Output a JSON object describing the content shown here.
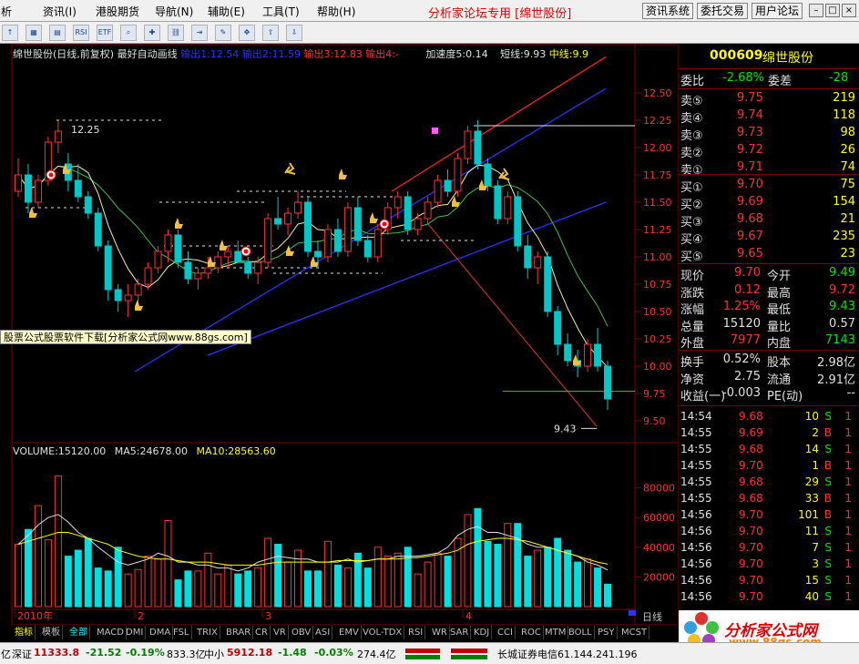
{
  "menu": {
    "items": [
      "析",
      "资讯(I)",
      "港股期货",
      "导航(N)",
      "辅助(E)",
      "工具(T)",
      "帮助(H)"
    ],
    "title": "分析家论坛专用 [绵世股份]",
    "system_buttons": [
      "资讯系统",
      "委托交易",
      "用户论坛"
    ],
    "window_buttons": [
      "–",
      "□",
      "×"
    ]
  },
  "toolbar": {
    "icons": [
      "arrow-up-icon",
      "chart-icon",
      "bar-chart-icon",
      "rsi-icon",
      "etf-icon",
      "zoom-icon",
      "tool-icon",
      "link-icon",
      "import-icon",
      "pen-icon",
      "move-icon",
      "up-arrow-icon",
      "down-arrow-icon"
    ],
    "labels": [
      "↑",
      "▦",
      "▤",
      "RSI",
      "ETF",
      "⌕",
      "✚",
      "⛓",
      "⇥",
      "✎",
      "✥",
      "⇧",
      "⇩"
    ]
  },
  "chart_header": {
    "name": "绵世股份(日线,前复权)",
    "mode": "最好自动画线",
    "out1": "输出1:12.54",
    "out2": "输出2:11.59",
    "out3": "输出3:12.83",
    "out4": "输出4:-",
    "accel": "加速度5:0.14",
    "short": "短线:9.93",
    "mid": "中线:9.9"
  },
  "annotations": {
    "high": "12.25",
    "low": "9.43"
  },
  "ad_banner": "股票公式股票软件下载[分析家公式网www.88gs.com]",
  "volume_header": {
    "volume": "VOLUME:15120.00",
    "ma5": "MA5:24678.00",
    "ma10": "MA10:28563.60"
  },
  "x_axis": {
    "labels": [
      "2010年",
      "2",
      "3",
      "4"
    ]
  },
  "day_tag": "日线",
  "chart_data": [
    {
      "type": "candlestick",
      "title": "绵世股份(日线,前复权)",
      "y_ticks": [
        "12.50",
        "12.25",
        "12.00",
        "11.75",
        "11.50",
        "11.25",
        "11.00",
        "10.75",
        "10.50",
        "10.25",
        "10.00",
        "9.75",
        "9.50"
      ],
      "ylim": [
        9.35,
        12.75
      ],
      "candles": [
        [
          11.6,
          11.9,
          11.55,
          11.75
        ],
        [
          11.75,
          11.85,
          11.4,
          11.5
        ],
        [
          11.5,
          11.75,
          11.45,
          11.7
        ],
        [
          11.7,
          12.1,
          11.65,
          12.05
        ],
        [
          12.05,
          12.25,
          11.95,
          12.15
        ],
        [
          11.85,
          11.95,
          11.6,
          11.7
        ],
        [
          11.7,
          11.85,
          11.5,
          11.55
        ],
        [
          11.55,
          11.6,
          11.35,
          11.4
        ],
        [
          11.4,
          11.45,
          11.05,
          11.1
        ],
        [
          11.1,
          11.15,
          10.6,
          10.7
        ],
        [
          10.7,
          10.75,
          10.5,
          10.6
        ],
        [
          10.6,
          10.75,
          10.45,
          10.65
        ],
        [
          10.65,
          10.8,
          10.55,
          10.75
        ],
        [
          10.75,
          10.95,
          10.7,
          10.9
        ],
        [
          10.9,
          11.1,
          10.85,
          11.05
        ],
        [
          11.05,
          11.25,
          10.95,
          11.2
        ],
        [
          11.2,
          11.25,
          10.9,
          10.95
        ],
        [
          10.95,
          11.05,
          10.75,
          10.8
        ],
        [
          10.8,
          10.9,
          10.7,
          10.85
        ],
        [
          10.85,
          11.0,
          10.8,
          10.9
        ],
        [
          10.9,
          11.05,
          10.85,
          11.0
        ],
        [
          11.0,
          11.1,
          10.9,
          11.05
        ],
        [
          11.05,
          11.15,
          10.95,
          10.95
        ],
        [
          10.95,
          11.0,
          10.8,
          10.85
        ],
        [
          10.85,
          11.0,
          10.75,
          10.95
        ],
        [
          10.95,
          11.4,
          10.9,
          11.35
        ],
        [
          11.35,
          11.55,
          11.25,
          11.3
        ],
        [
          11.3,
          11.45,
          11.2,
          11.4
        ],
        [
          11.4,
          11.6,
          11.35,
          11.5
        ],
        [
          11.5,
          11.55,
          11.0,
          11.05
        ],
        [
          11.05,
          11.15,
          10.9,
          11.0
        ],
        [
          11.0,
          11.3,
          10.95,
          11.25
        ],
        [
          11.25,
          11.35,
          11.0,
          11.05
        ],
        [
          11.05,
          11.5,
          11.0,
          11.45
        ],
        [
          11.45,
          11.55,
          11.1,
          11.15
        ],
        [
          11.15,
          11.2,
          10.95,
          11.0
        ],
        [
          11.0,
          11.3,
          10.95,
          11.25
        ],
        [
          11.25,
          11.5,
          11.2,
          11.45
        ],
        [
          11.45,
          11.6,
          11.35,
          11.55
        ],
        [
          11.55,
          11.6,
          11.2,
          11.25
        ],
        [
          11.25,
          11.4,
          11.2,
          11.35
        ],
        [
          11.35,
          11.55,
          11.3,
          11.5
        ],
        [
          11.5,
          11.75,
          11.45,
          11.7
        ],
        [
          11.7,
          11.8,
          11.55,
          11.6
        ],
        [
          11.6,
          11.95,
          11.55,
          11.9
        ],
        [
          11.9,
          12.2,
          11.85,
          12.15
        ],
        [
          12.15,
          12.25,
          11.8,
          11.85
        ],
        [
          11.85,
          11.9,
          11.6,
          11.65
        ],
        [
          11.65,
          11.7,
          11.3,
          11.35
        ],
        [
          11.35,
          11.6,
          11.3,
          11.55
        ],
        [
          11.55,
          11.6,
          11.05,
          11.1
        ],
        [
          11.1,
          11.2,
          10.8,
          10.9
        ],
        [
          10.9,
          11.05,
          10.75,
          11.0
        ],
        [
          11.0,
          11.05,
          10.45,
          10.5
        ],
        [
          10.5,
          10.55,
          10.1,
          10.2
        ],
        [
          10.2,
          10.3,
          10.0,
          10.05
        ],
        [
          10.05,
          10.15,
          9.9,
          10.0
        ],
        [
          10.0,
          10.25,
          9.95,
          10.2
        ],
        [
          10.2,
          10.35,
          9.95,
          10.0
        ],
        [
          10.0,
          10.05,
          9.6,
          9.7
        ]
      ],
      "lines": [
        {
          "name": "输出1",
          "color": "#3030ff",
          "from": [
            9.95
          ],
          "to": [
            12.54
          ]
        },
        {
          "name": "输出3",
          "color": "#ff2020",
          "from": [
            11.6
          ],
          "to": [
            12.83
          ]
        }
      ]
    },
    {
      "type": "bar",
      "title": "VOLUME",
      "y_ticks": [
        "80000",
        "60000",
        "40000",
        "20000"
      ],
      "ylim": [
        0,
        100000
      ],
      "values": [
        42000,
        52000,
        68000,
        45000,
        88000,
        34000,
        38000,
        46000,
        26000,
        24000,
        40000,
        22000,
        25000,
        34000,
        32000,
        58000,
        18000,
        24000,
        24000,
        36000,
        22000,
        28000,
        22000,
        24000,
        26000,
        46000,
        42000,
        30000,
        38000,
        24000,
        24000,
        44000,
        28000,
        26000,
        36000,
        26000,
        40000,
        34000,
        36000,
        40000,
        22000,
        30000,
        36000,
        34000,
        46000,
        62000,
        66000,
        44000,
        42000,
        56000,
        56000,
        34000,
        38000,
        40000,
        46000,
        38000,
        30000,
        32000,
        26000,
        15120
      ],
      "ma5": [
        42000,
        48000,
        55000,
        60000,
        62000,
        57000,
        50000,
        46000,
        40000,
        35000,
        30000,
        28000,
        30000,
        32000,
        36000,
        34000,
        30000,
        30000,
        28000,
        28000,
        26000,
        26000,
        24000,
        26000,
        30000,
        32000,
        34000,
        33000,
        32000,
        32000,
        30000,
        30000,
        30000,
        32000,
        30000,
        31000,
        32000,
        32000,
        34000,
        34000,
        34000,
        35000,
        36000,
        40000,
        48000,
        52000,
        54000,
        50000,
        50000,
        48000,
        46000,
        42000,
        40000,
        40000,
        38000,
        36000,
        34000,
        30000,
        28000,
        24678
      ],
      "ma10": [
        42000,
        44000,
        46000,
        48000,
        50000,
        50000,
        48000,
        46000,
        44000,
        42000,
        38000,
        36000,
        34000,
        33000,
        32000,
        32000,
        31000,
        30000,
        30000,
        30000,
        29000,
        28000,
        28000,
        28000,
        28000,
        29000,
        30000,
        30000,
        30000,
        30000,
        30000,
        30000,
        31000,
        31000,
        31000,
        31000,
        32000,
        32000,
        32000,
        33000,
        33000,
        34000,
        35000,
        36000,
        38000,
        42000,
        44000,
        45000,
        46000,
        46000,
        45000,
        44000,
        42000,
        40000,
        38000,
        36000,
        34000,
        32000,
        30000,
        28563.6
      ]
    }
  ],
  "quote": {
    "code": "000609",
    "name": "绵世股份",
    "weibi_label": "委比",
    "weibi": "-2.68%",
    "weicha_label": "委差",
    "weicha": "-28",
    "sells": [
      {
        "label": "卖⑤",
        "price": "9.75",
        "vol": "219"
      },
      {
        "label": "卖④",
        "price": "9.74",
        "vol": "118"
      },
      {
        "label": "卖③",
        "price": "9.73",
        "vol": "98"
      },
      {
        "label": "卖②",
        "price": "9.72",
        "vol": "26"
      },
      {
        "label": "卖①",
        "price": "9.71",
        "vol": "74"
      }
    ],
    "buys": [
      {
        "label": "买①",
        "price": "9.70",
        "vol": "75"
      },
      {
        "label": "买②",
        "price": "9.69",
        "vol": "154"
      },
      {
        "label": "买③",
        "price": "9.68",
        "vol": "21"
      },
      {
        "label": "买④",
        "price": "9.67",
        "vol": "235"
      },
      {
        "label": "买⑤",
        "price": "9.65",
        "vol": "23"
      }
    ],
    "stats": [
      {
        "l1": "现价",
        "v1": "9.70",
        "l2": "今开",
        "v2": "9.49",
        "c1": "red",
        "c2": "grn"
      },
      {
        "l1": "涨跌",
        "v1": "0.12",
        "l2": "最高",
        "v2": "9.72",
        "c1": "red",
        "c2": "red"
      },
      {
        "l1": "涨幅",
        "v1": "1.25%",
        "l2": "最低",
        "v2": "9.43",
        "c1": "red",
        "c2": "grn"
      },
      {
        "l1": "总量",
        "v1": "15120",
        "l2": "量比",
        "v2": "0.57",
        "c1": "wht",
        "c2": "wht"
      },
      {
        "l1": "外盘",
        "v1": "7977",
        "l2": "内盘",
        "v2": "7143",
        "c1": "red",
        "c2": "grn"
      }
    ],
    "fundamentals": [
      {
        "l1": "换手",
        "v1": "0.52%",
        "l2": "股本",
        "v2": "2.98亿"
      },
      {
        "l1": "净资",
        "v1": "2.75",
        "l2": "流通",
        "v2": "2.91亿"
      },
      {
        "l1": "收益(一)",
        "v1": "-0.003",
        "l2": "PE(动)",
        "v2": "--"
      }
    ]
  },
  "ticks": [
    {
      "time": "14:54",
      "price": "9.68",
      "vol": "10",
      "side": "S"
    },
    {
      "time": "14:55",
      "price": "9.69",
      "vol": "2",
      "side": "B"
    },
    {
      "time": "14:55",
      "price": "9.68",
      "vol": "14",
      "side": "S"
    },
    {
      "time": "14:55",
      "price": "9.70",
      "vol": "1",
      "side": "B"
    },
    {
      "time": "14:55",
      "price": "9.68",
      "vol": "29",
      "side": "S"
    },
    {
      "time": "14:55",
      "price": "9.68",
      "vol": "33",
      "side": "B"
    },
    {
      "time": "14:56",
      "price": "9.70",
      "vol": "101",
      "side": "B"
    },
    {
      "time": "14:56",
      "price": "9.70",
      "vol": "11",
      "side": "S"
    },
    {
      "time": "14:56",
      "price": "9.70",
      "vol": "7",
      "side": "S"
    },
    {
      "time": "14:56",
      "price": "9.70",
      "vol": "3",
      "side": "S"
    },
    {
      "time": "14:56",
      "price": "9.70",
      "vol": "15",
      "side": "S"
    },
    {
      "time": "14:56",
      "price": "9.70",
      "vol": "40",
      "side": "S"
    }
  ],
  "tabs": [
    "指标",
    "模板",
    "全部",
    "MACD",
    "DMI",
    "DMA",
    "FSL",
    "TRIX",
    "BRAR",
    "CR",
    "VR",
    "OBV",
    "ASI",
    "EMV",
    "VOL-TDX",
    "RSI",
    "WR",
    "SAR",
    "KDJ",
    "CCI",
    "ROC",
    "MTM",
    "BOLL",
    "PSY",
    "MCST"
  ],
  "status": {
    "prefix": "亿",
    "sz_label": "深证",
    "sz_value": "11333.8",
    "sz_change": "-21.52",
    "sz_pct": "-0.19%",
    "sz_amount": "833.3亿",
    "zx_label": "中小",
    "zx_value": "5912.18",
    "zx_change": "-1.48",
    "zx_pct": "-0.03%",
    "zx_amount": "274.4亿",
    "broker": "长城证券电信61.144.241.196"
  },
  "logo": {
    "title": "分析家公式网",
    "url": "www.88gs.com"
  }
}
